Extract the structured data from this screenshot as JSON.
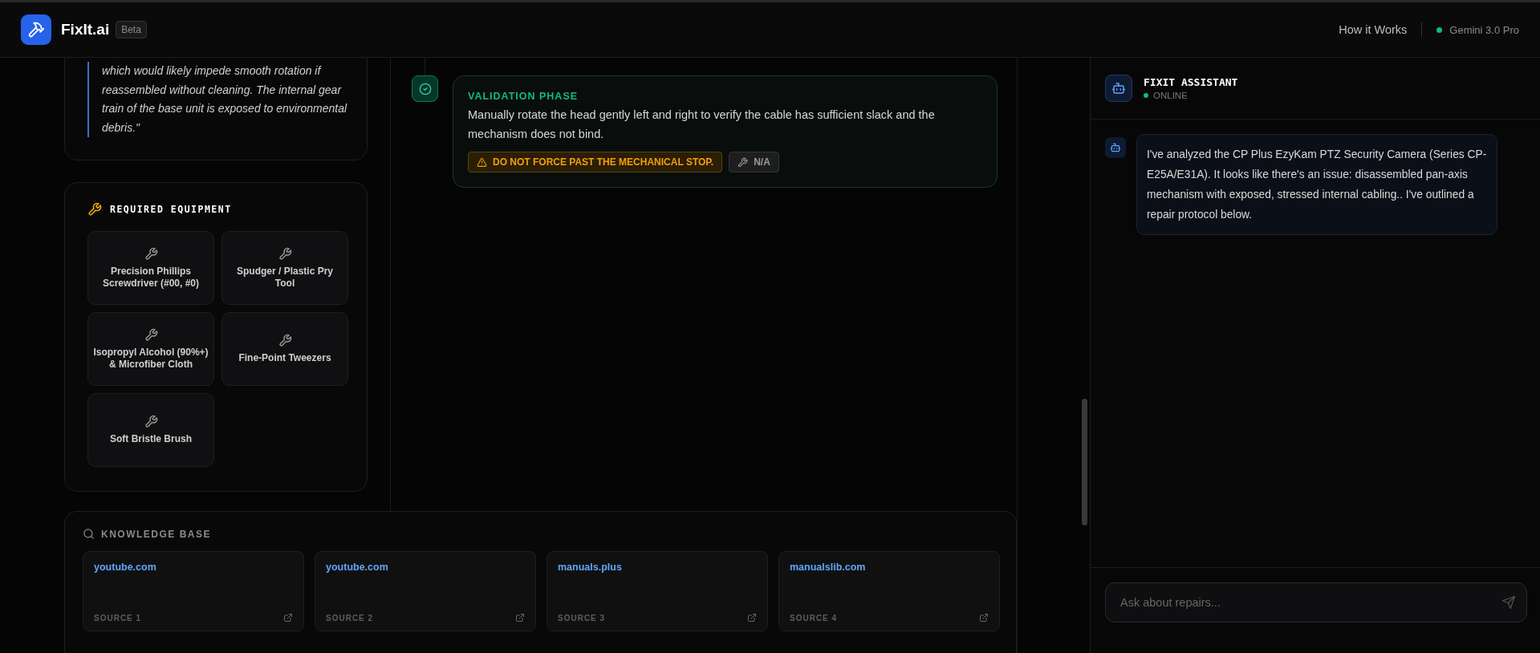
{
  "header": {
    "app_name": "FixIt.ai",
    "badge": "Beta",
    "nav_link": "How it Works",
    "model": "Gemini 3.0 Pro"
  },
  "diagnosis": {
    "quote": "which would likely impede smooth rotation if reassembled without cleaning. The internal gear train of the base unit is exposed to environmental debris.\""
  },
  "equipment": {
    "title": "REQUIRED EQUIPMENT",
    "items": [
      {
        "name": "Precision Phillips Screwdriver (#00, #0)"
      },
      {
        "name": "Spudger / Plastic Pry Tool"
      },
      {
        "name": "Isopropyl Alcohol (90%+) & Microfiber Cloth"
      },
      {
        "name": "Fine-Point Tweezers"
      },
      {
        "name": "Soft Bristle Brush"
      }
    ]
  },
  "steps": [
    {
      "phase": "VALIDATION PHASE",
      "done": true,
      "text": "Manually rotate the head gently left and right to verify the cable has sufficient slack and the mechanism does not bind.",
      "warning": "DO NOT FORCE PAST THE MECHANICAL STOP.",
      "tool": "N/A"
    }
  ],
  "knowledge_base": {
    "title": "KNOWLEDGE BASE",
    "sources": [
      {
        "site": "youtube.com",
        "label": "SOURCE 1"
      },
      {
        "site": "youtube.com",
        "label": "SOURCE 2"
      },
      {
        "site": "manuals.plus",
        "label": "SOURCE 3"
      },
      {
        "site": "manualslib.com",
        "label": "SOURCE 4"
      }
    ]
  },
  "assistant": {
    "title": "FIXIT ASSISTANT",
    "status": "ONLINE",
    "messages": [
      {
        "kind": "assistant",
        "text": "I've analyzed the CP Plus EzyKam PTZ Security Camera (Series CP-E25A/E31A). It looks like there's an issue: disassembled pan-axis mechanism with exposed, stressed internal cabling.. I've outlined a repair protocol below."
      }
    ],
    "input": {
      "placeholder": "Ask about repairs..."
    }
  }
}
